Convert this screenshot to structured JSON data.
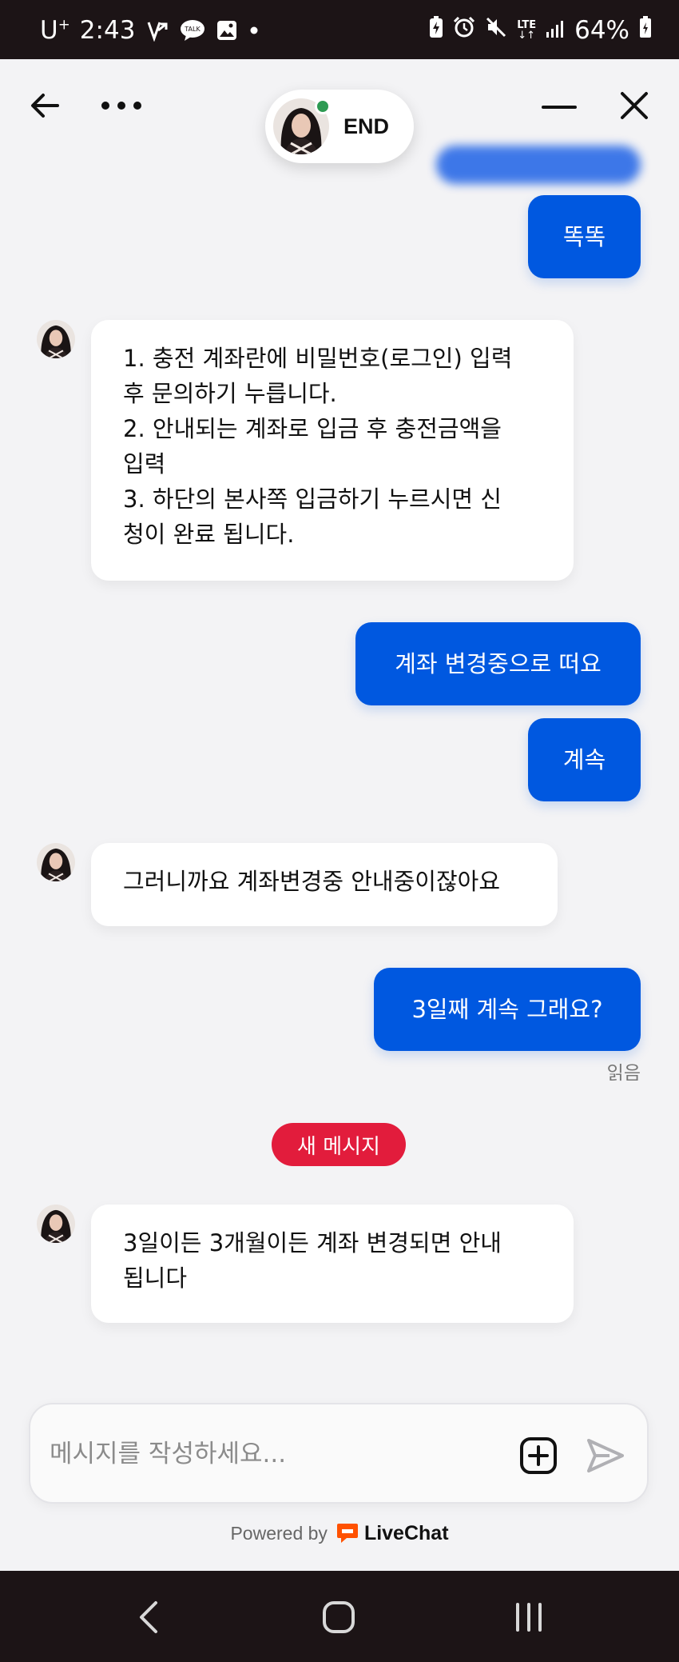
{
  "status_bar": {
    "carrier": "U",
    "carrier_sup": "+",
    "time": "2:43",
    "network": "LTE",
    "battery": "64%"
  },
  "header": {
    "end_label": "END"
  },
  "messages": [
    {
      "dir": "out",
      "lines": [
        "똑똑"
      ]
    },
    {
      "dir": "in",
      "lines": [
        "1. 충전 계좌란에 비밀번호(로그인) 입력",
        "후 문의하기 누릅니다.",
        "2. 안내되는 계좌로 입금 후 충전금액을",
        "입력",
        "3. 하단의 본사쪽 입금하기 누르시면 신",
        "청이 완료 됩니다."
      ]
    },
    {
      "dir": "out",
      "lines": [
        "계좌 변경중으로 떠요"
      ]
    },
    {
      "dir": "out",
      "lines": [
        "계속"
      ]
    },
    {
      "dir": "in",
      "lines": [
        "그러니까요 계좌변경중 안내중이잖아요"
      ]
    },
    {
      "dir": "out",
      "lines": [
        "3일째 계속 그래요?"
      ]
    },
    {
      "dir": "in",
      "lines": [
        "3일이든 3개월이든 계좌 변경되면 안내",
        "됩니다"
      ]
    }
  ],
  "read_receipt": "읽음",
  "new_message_badge": "새 메시지",
  "composer": {
    "placeholder": "메시지를 작성하세요..."
  },
  "footer": {
    "powered_by": "Powered by",
    "brand": "LiveChat"
  },
  "colors": {
    "outgoing_bubble": "#0058e0",
    "new_badge": "#e21c3c",
    "brand_orange": "#ff5100",
    "online_dot": "#2d9a52"
  }
}
